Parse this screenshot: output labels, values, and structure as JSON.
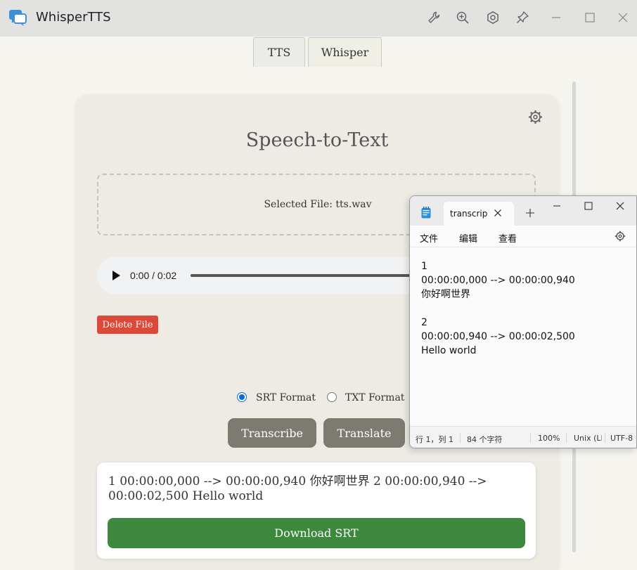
{
  "app": {
    "title": "WhisperTTS"
  },
  "toolbar": {
    "icons": [
      "wrench-icon",
      "zoom-in-icon",
      "settings-icon",
      "pin-icon",
      "minimize-icon",
      "maximize-icon",
      "close-icon"
    ]
  },
  "tabs": [
    {
      "label": "TTS",
      "active": false
    },
    {
      "label": "Whisper",
      "active": true
    }
  ],
  "main": {
    "title": "Speech-to-Text",
    "selected_file": "Selected File: tts.wav",
    "player": {
      "time": "0:00 / 0:02",
      "progress": 0
    },
    "delete_label": "Delete File",
    "formats": [
      {
        "label": "SRT Format",
        "checked": true
      },
      {
        "label": "TXT Format",
        "checked": false
      }
    ],
    "transcribe_label": "Transcribe",
    "translate_label": "Translate",
    "result_text": "1 00:00:00,000 --> 00:00:00,940 你好啊世界 2 00:00:00,940 --> 00:00:02,500 Hello world",
    "download_label": "Download SRT"
  },
  "notepad": {
    "tab_title": "transcrip",
    "menu": [
      "文件",
      "编辑",
      "查看"
    ],
    "content": "1\n00:00:00,000 --> 00:00:00,940\n你好啊世界\n\n2\n00:00:00,940 --> 00:00:02,500\nHello world",
    "status": {
      "position": "行 1，列 1",
      "chars": "84 个字符",
      "zoom": "100%",
      "line_ending": "Unix (LF",
      "encoding": "UTF-8"
    }
  },
  "colors": {
    "delete": "#dd4838",
    "download": "#3c893e",
    "action": "#7d7a72",
    "radio_accent": "#0b6bd8"
  }
}
